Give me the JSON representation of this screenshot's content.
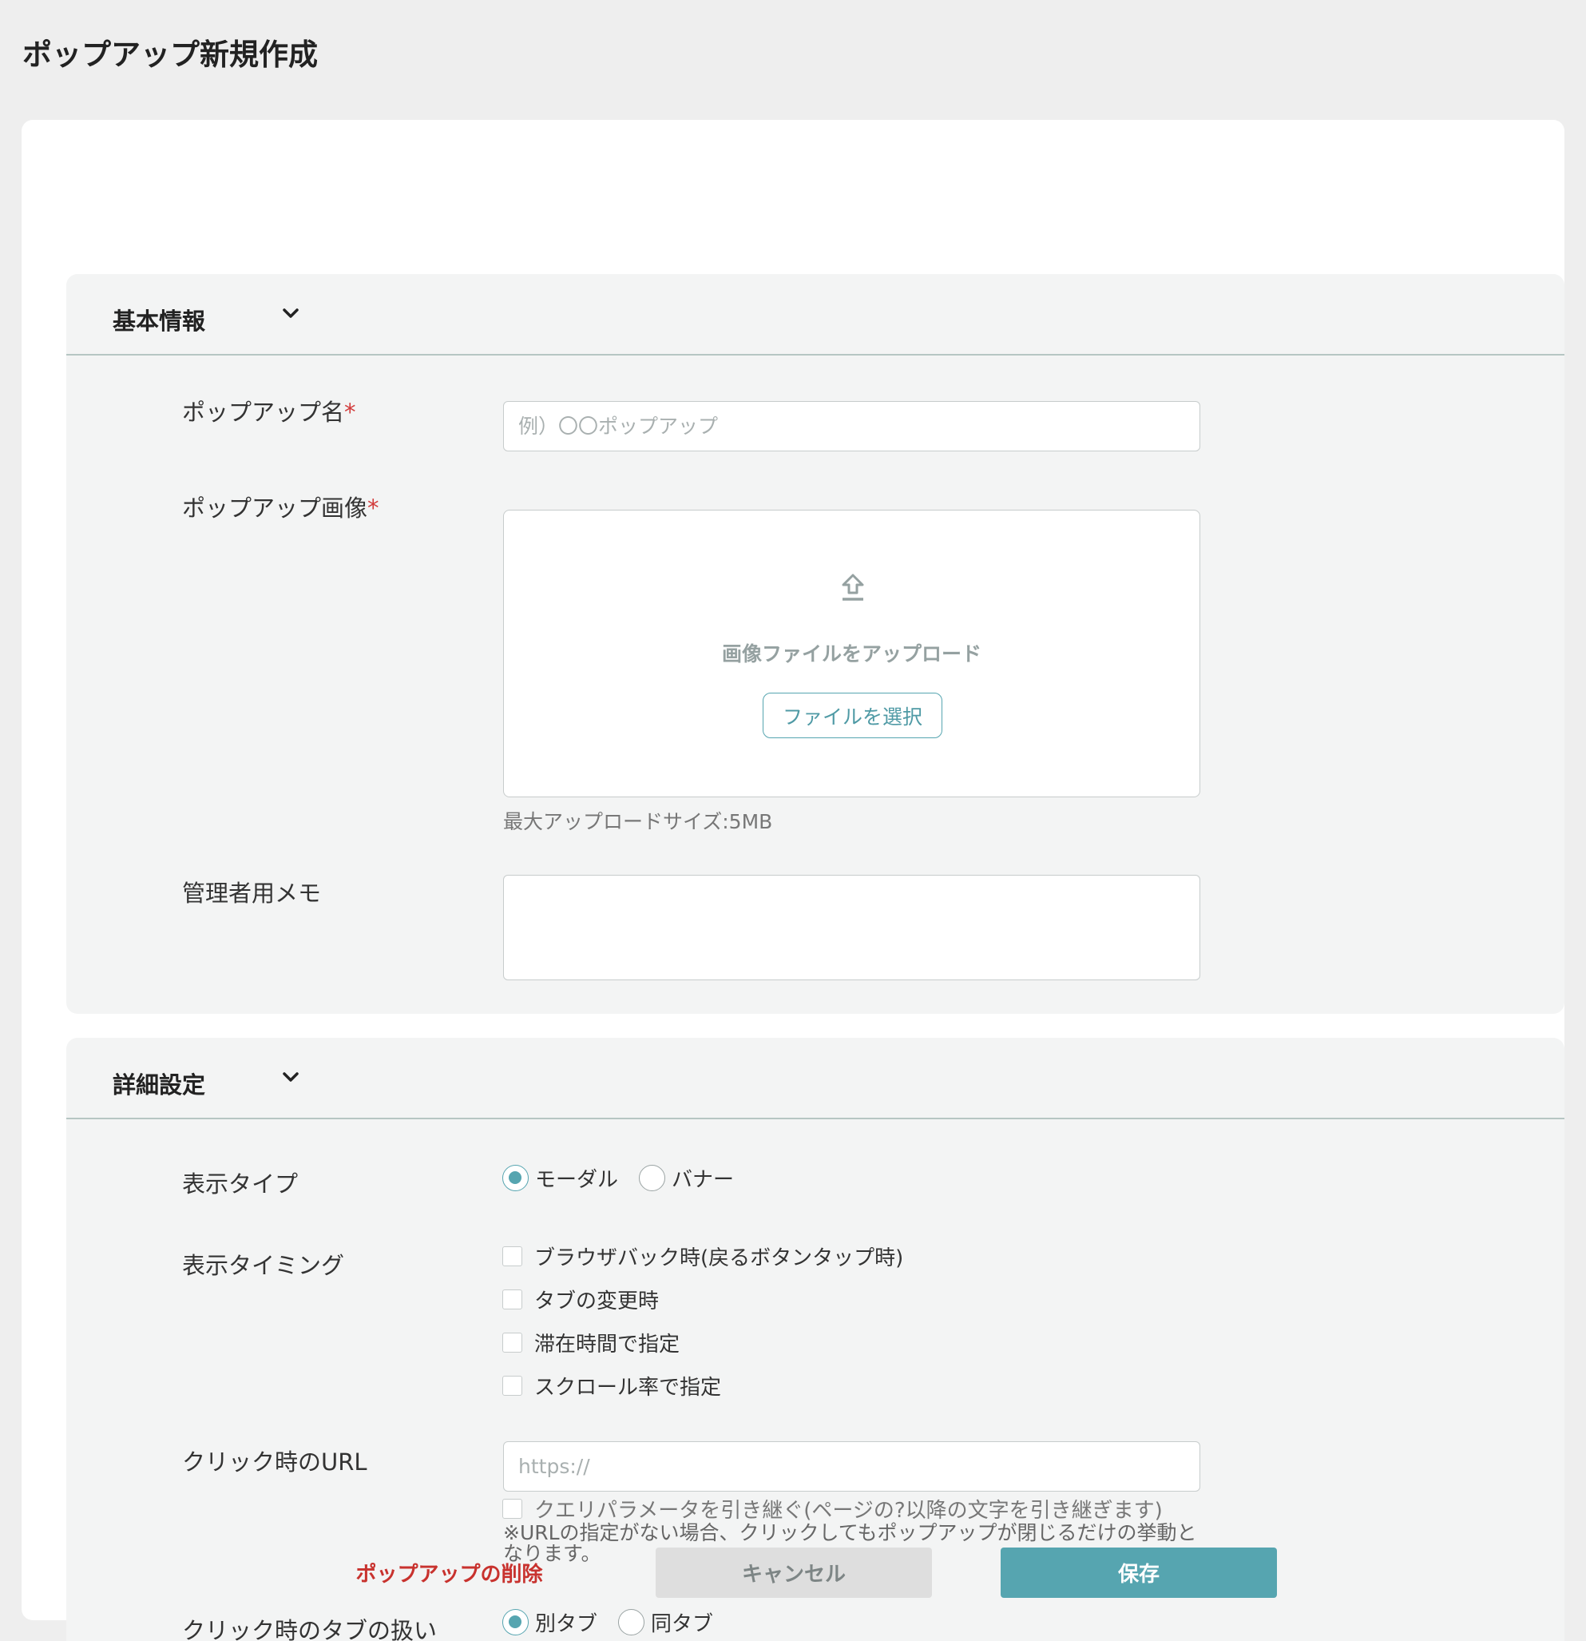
{
  "page": {
    "title": "ポップアップ新規作成"
  },
  "basic_section": {
    "title": "基本情報",
    "name_label": "ポップアップ名",
    "name_placeholder": "例）〇〇ポップアップ",
    "image_label": "ポップアップ画像",
    "required_mark": "*",
    "upload_text": "画像ファイルをアップロード",
    "file_button": "ファイルを選択",
    "max_size_hint": "最大アップロードサイズ:5MB",
    "memo_label": "管理者用メモ"
  },
  "detail_section": {
    "title": "詳細設定",
    "display_type_label": "表示タイプ",
    "display_type_options": [
      "モーダル",
      "バナー"
    ],
    "display_type_selected": "モーダル",
    "timing_label": "表示タイミング",
    "timing_options": [
      "ブラウザバック時(戻るボタンタップ時)",
      "タブの変更時",
      "滞在時間で指定",
      "スクロール率で指定"
    ],
    "url_label": "クリック時のURL",
    "url_placeholder": "https://",
    "query_param_label": "クエリパラメータを引き継ぐ(ページの?以降の文字を引き継ぎます)",
    "url_note": "※URLの指定がない場合、クリックしてもポップアップが閉じるだけの挙動となります。",
    "tab_label": "クリック時のタブの扱い",
    "tab_options": [
      "別タブ",
      "同タブ"
    ],
    "tab_selected": "別タブ"
  },
  "footer": {
    "delete_label": "ポップアップの削除",
    "cancel_label": "キャンセル",
    "save_label": "保存"
  },
  "colors": {
    "accent": "#56a5b0",
    "danger": "#c8322e",
    "background": "#eeeeee"
  }
}
